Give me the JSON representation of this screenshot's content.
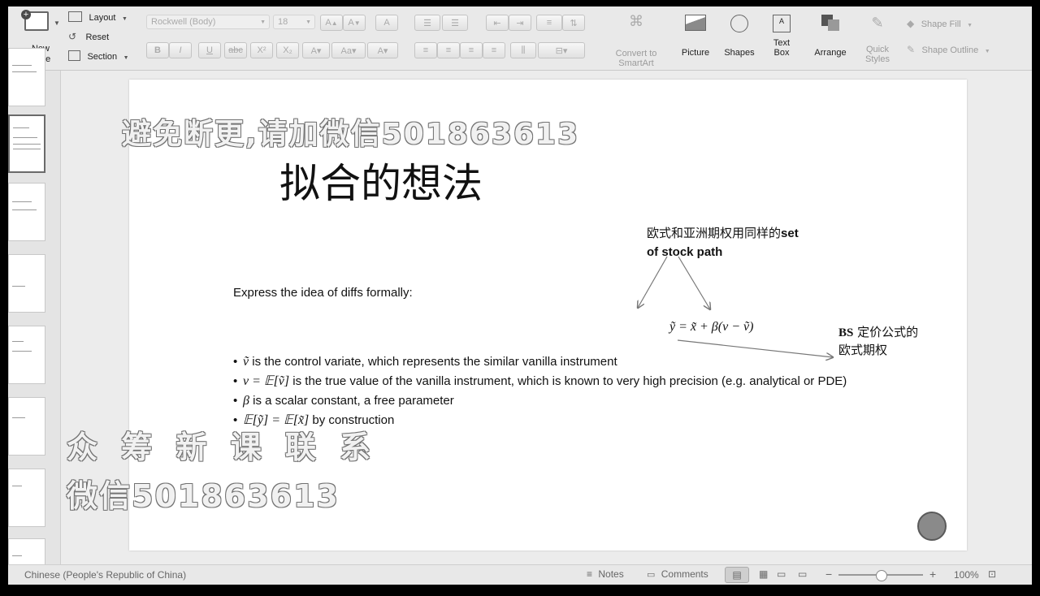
{
  "ribbon": {
    "new_slide": "New\nSlide",
    "layout": "Layout",
    "reset": "Reset",
    "section": "Section",
    "font_name": "Rockwell (Body)",
    "font_size": "18",
    "bold": "B",
    "italic": "I",
    "underline": "U",
    "strike": "abc",
    "superscript": "X²",
    "subscript": "X₂",
    "convert_smartart_1": "Convert to",
    "convert_smartart_2": "SmartArt",
    "picture": "Picture",
    "shapes": "Shapes",
    "text_box_1": "Text",
    "text_box_2": "Box",
    "arrange": "Arrange",
    "quick_styles_1": "Quick",
    "quick_styles_2": "Styles",
    "shape_fill": "Shape Fill",
    "shape_outline": "Shape Outline"
  },
  "slide": {
    "watermark_top": "避免断更,请加微信501863613",
    "title": "拟合的想法",
    "note_top_line1": "欧式和亚洲期权用同样的",
    "note_top_line1_bold": "set",
    "note_top_line2": "of stock path",
    "express": "Express the idea of diffs formally:",
    "formula": "ỹ = x̃ + β(v − ṽ)",
    "note_bs_bold": "BS",
    "note_bs_line1": " 定价公式的",
    "note_bs_line2": "欧式期权",
    "bullets": [
      {
        "math": "ṽ",
        "text": " is the control variate, which represents the similar vanilla instrument"
      },
      {
        "math": "v = 𝔼[ṽ]",
        "text": " is the true value of the vanilla instrument, which is known to very high precision (e.g. analytical or PDE)"
      },
      {
        "math": "β",
        "text": " is a scalar constant, a free parameter"
      },
      {
        "math": "𝔼[ỹ] = 𝔼[x̃]",
        "text": " by construction"
      }
    ],
    "watermark_bottom_1": "众 筹 新 课 联 系",
    "watermark_bottom_2": "微信501863613"
  },
  "status": {
    "language": "Chinese (People's Republic of China)",
    "notes": "Notes",
    "comments": "Comments",
    "zoom": "100%"
  }
}
